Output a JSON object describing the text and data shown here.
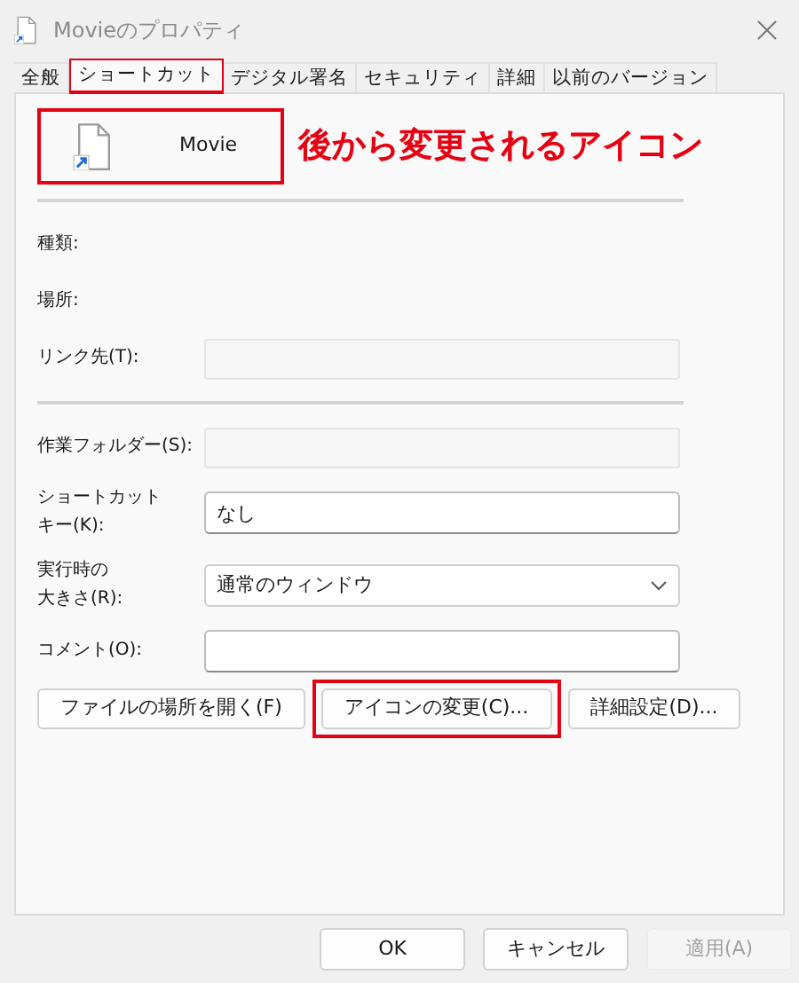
{
  "window": {
    "title": "Movieのプロパティ"
  },
  "tabs": [
    {
      "label": "全般",
      "selected": false,
      "highlighted": false
    },
    {
      "label": "ショートカット",
      "selected": true,
      "highlighted": true
    },
    {
      "label": "デジタル署名",
      "selected": false,
      "highlighted": false
    },
    {
      "label": "セキュリティ",
      "selected": false,
      "highlighted": false
    },
    {
      "label": "詳細",
      "selected": false,
      "highlighted": false
    },
    {
      "label": "以前のバージョン",
      "selected": false,
      "highlighted": false
    }
  ],
  "header": {
    "name": "Movie",
    "highlighted": true,
    "note": "後から変更されるアイコン"
  },
  "info_rows": [
    {
      "label": [
        "種類:"
      ],
      "kind": "static"
    },
    {
      "label": [
        "場所:"
      ],
      "kind": "static"
    },
    {
      "label": [
        "リンク先(T):"
      ],
      "kind": "readonly"
    }
  ],
  "fields": [
    {
      "label": [
        "作業フォルダー(S):"
      ],
      "kind": "readonly"
    },
    {
      "label": [
        "ショートカット",
        "キー(K):"
      ],
      "kind": "text",
      "value": "なし"
    },
    {
      "label": [
        "実行時の",
        "大きさ(R):"
      ],
      "kind": "select",
      "value": "通常のウィンドウ"
    },
    {
      "label": [
        "コメント(O):"
      ],
      "kind": "text"
    }
  ],
  "actions": [
    {
      "label": "ファイルの場所を開く(F)",
      "highlighted": false
    },
    {
      "label": "アイコンの変更(C)...",
      "highlighted": true
    },
    {
      "label": "詳細設定(D)...",
      "highlighted": false
    }
  ],
  "buttons": [
    {
      "label": "OK",
      "disabled": false
    },
    {
      "label": "キャンセル",
      "disabled": false
    },
    {
      "label": "適用(A)",
      "disabled": true
    }
  ]
}
